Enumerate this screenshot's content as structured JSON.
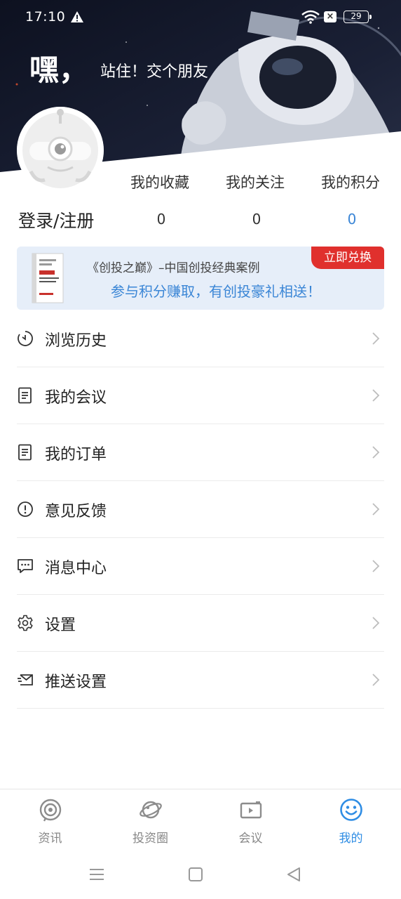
{
  "status_bar": {
    "time": "17:10",
    "battery": "29",
    "icons": [
      "warning-icon",
      "wifi-icon",
      "x-box-icon",
      "battery-icon"
    ]
  },
  "header": {
    "greeting_big": "嘿，",
    "greeting_small": "站住！交个朋友"
  },
  "user": {
    "login_label": "登录/注册"
  },
  "stats": [
    {
      "label": "我的收藏",
      "value": "0"
    },
    {
      "label": "我的关注",
      "value": "0"
    },
    {
      "label": "我的积分",
      "value": "0"
    }
  ],
  "banner": {
    "line1": "《创投之巅》–中国创投经典案例",
    "line2": "参与积分赚取，有创投豪礼相送！",
    "button": "立即兑换"
  },
  "menu": [
    {
      "label": "浏览历史",
      "icon": "clock-icon"
    },
    {
      "label": "我的会议",
      "icon": "document-icon"
    },
    {
      "label": "我的订单",
      "icon": "document-icon"
    },
    {
      "label": "意见反馈",
      "icon": "exclamation-icon"
    },
    {
      "label": "消息中心",
      "icon": "chat-icon"
    },
    {
      "label": "设置",
      "icon": "gear-icon"
    },
    {
      "label": "推送设置",
      "icon": "envelope-icon"
    }
  ],
  "tabs": [
    {
      "label": "资讯",
      "icon": "news-icon",
      "active": false
    },
    {
      "label": "投资圈",
      "icon": "planet-icon",
      "active": false
    },
    {
      "label": "会议",
      "icon": "camera-icon",
      "active": false
    },
    {
      "label": "我的",
      "icon": "smiley-icon",
      "active": true
    }
  ],
  "colors": {
    "accent": "#2f8de4",
    "points_value": "#3b86d6",
    "banner_bg": "#e6eef9",
    "banner_button": "#e0302d",
    "header_dark": "#15192a"
  }
}
